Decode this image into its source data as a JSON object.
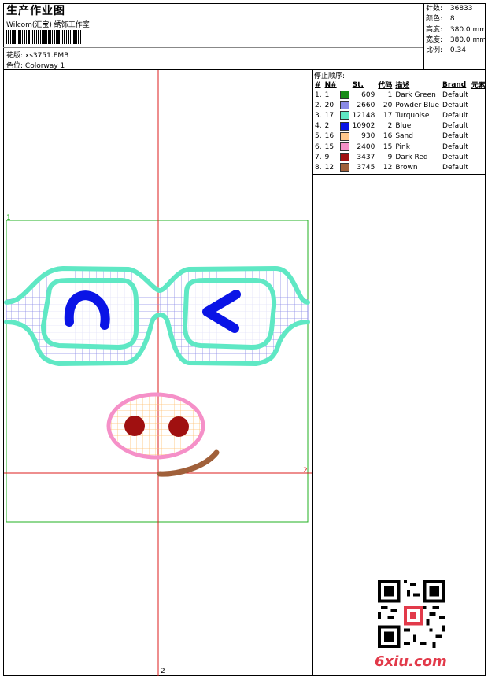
{
  "header": {
    "title": "生产作业图",
    "studio": "Wilcom(汇宝) 绣饰工作室",
    "design_label": "花版:",
    "design_value": "xs3751.EMB",
    "colorway_label": "色位:",
    "colorway_value": "Colorway 1"
  },
  "stats": [
    {
      "label": "针数:",
      "value": "36833"
    },
    {
      "label": "颜色:",
      "value": "8"
    },
    {
      "label": "高度:",
      "value": "380.0 mm"
    },
    {
      "label": "宽度:",
      "value": "380.0 mm"
    },
    {
      "label": "比例:",
      "value": "0.34"
    }
  ],
  "sequence": {
    "title": "停止顺序:",
    "headers": [
      "#",
      "N#",
      "",
      "St.",
      "代码",
      "描述",
      "Brand",
      "元素"
    ],
    "rows": [
      {
        "idx": "1.",
        "n": "1",
        "color": "#1a8c1a",
        "st": "609",
        "code": "1",
        "desc": "Dark Green",
        "brand": "Default"
      },
      {
        "idx": "2.",
        "n": "20",
        "color": "#8a8ae6",
        "st": "2660",
        "code": "20",
        "desc": "Powder Blue",
        "brand": "Default"
      },
      {
        "idx": "3.",
        "n": "17",
        "color": "#5fe8c4",
        "st": "12148",
        "code": "17",
        "desc": "Turquoise",
        "brand": "Default"
      },
      {
        "idx": "4.",
        "n": "2",
        "color": "#0a14e6",
        "st": "10902",
        "code": "2",
        "desc": "Blue",
        "brand": "Default"
      },
      {
        "idx": "5.",
        "n": "16",
        "color": "#ffc88c",
        "st": "930",
        "code": "16",
        "desc": "Sand",
        "brand": "Default"
      },
      {
        "idx": "6.",
        "n": "15",
        "color": "#f590c8",
        "st": "2400",
        "code": "15",
        "desc": "Pink",
        "brand": "Default"
      },
      {
        "idx": "7.",
        "n": "9",
        "color": "#a01010",
        "st": "3437",
        "code": "9",
        "desc": "Dark Red",
        "brand": "Default"
      },
      {
        "idx": "8.",
        "n": "12",
        "color": "#a0603a",
        "st": "3745",
        "code": "12",
        "desc": "Brown",
        "brand": "Default"
      }
    ]
  },
  "markers": {
    "bounds_corner": "1",
    "axis_right": "2",
    "axis_bottom": "2"
  },
  "watermark": "6xiu.com"
}
